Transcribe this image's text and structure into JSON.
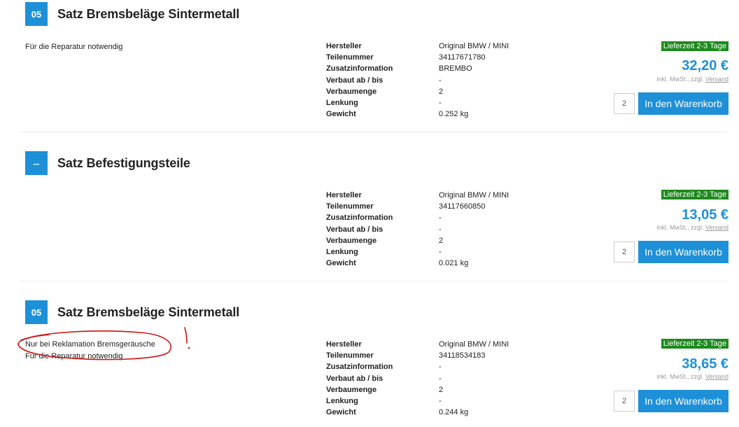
{
  "items": [
    {
      "badge": "05",
      "title": "Satz Bremsbeläge Sintermetall",
      "notes": [
        "Für die Reparatur notwendig"
      ],
      "specs": [
        {
          "label": "Hersteller",
          "value": "Original BMW / MINI"
        },
        {
          "label": "Teilenummer",
          "value": "34117671780"
        },
        {
          "label": "Zusatzinformation",
          "value": "BREMBO"
        },
        {
          "label": "Verbaut ab / bis",
          "value": "-"
        },
        {
          "label": "Verbaumenge",
          "value": "2"
        },
        {
          "label": "Lenkung",
          "value": "-"
        },
        {
          "label": "Gewicht",
          "value": "0.252 kg"
        }
      ],
      "delivery": "Lieferzeit 2-3 Tage",
      "price": "32,20 €",
      "tax_prefix": "inkl. MwSt., zzgl.",
      "tax_link": "Versand",
      "qty": "2",
      "cart_label": "In den Warenkorb"
    },
    {
      "badge": "--",
      "title": "Satz Befestigungsteile",
      "notes": [],
      "specs": [
        {
          "label": "Hersteller",
          "value": "Original BMW / MINI"
        },
        {
          "label": "Teilenummer",
          "value": "34117660850"
        },
        {
          "label": "Zusatzinformation",
          "value": "-"
        },
        {
          "label": "Verbaut ab / bis",
          "value": "-"
        },
        {
          "label": "Verbaumenge",
          "value": "2"
        },
        {
          "label": "Lenkung",
          "value": "-"
        },
        {
          "label": "Gewicht",
          "value": "0.021 kg"
        }
      ],
      "delivery": "Lieferzeit 2-3 Tage",
      "price": "13,05 €",
      "tax_prefix": "inkl. MwSt., zzgl.",
      "tax_link": "Versand",
      "qty": "2",
      "cart_label": "In den Warenkorb"
    },
    {
      "badge": "05",
      "title": "Satz Bremsbeläge Sintermetall",
      "notes": [
        "Nur bei Reklamation Bremsgeräusche",
        "Für die Reparatur notwendig"
      ],
      "specs": [
        {
          "label": "Hersteller",
          "value": "Original BMW / MINI"
        },
        {
          "label": "Teilenummer",
          "value": "34118534183"
        },
        {
          "label": "Zusatzinformation",
          "value": "-"
        },
        {
          "label": "Verbaut ab / bis",
          "value": "-"
        },
        {
          "label": "Verbaumenge",
          "value": "2"
        },
        {
          "label": "Lenkung",
          "value": "-"
        },
        {
          "label": "Gewicht",
          "value": "0.244 kg"
        }
      ],
      "delivery": "Lieferzeit 2-3 Tage",
      "price": "38,65 €",
      "tax_prefix": "inkl. MwSt., zzgl.",
      "tax_link": "Versand",
      "qty": "2",
      "cart_label": "In den Warenkorb"
    }
  ],
  "colors": {
    "accent": "#1e90d8",
    "delivery_green": "#1e8a1e",
    "annotation_red": "#d01010"
  }
}
